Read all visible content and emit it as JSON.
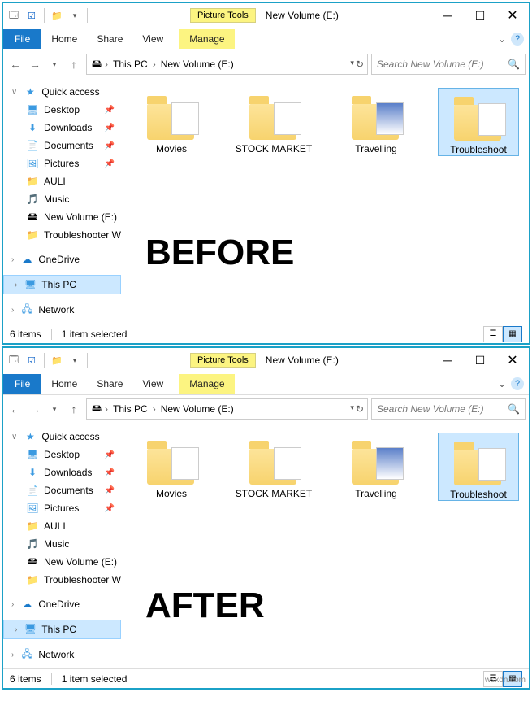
{
  "watermark": "wsxdn.com",
  "windows": [
    {
      "overlay": "BEFORE",
      "title": "New Volume (E:)",
      "contextTab": "Picture Tools",
      "ribbon": {
        "file": "File",
        "tabs": [
          "Home",
          "Share",
          "View"
        ],
        "manage": "Manage"
      },
      "breadcrumb": [
        "This PC",
        "New Volume (E:)"
      ],
      "searchPlaceholder": "Search New Volume (E:)",
      "nav": {
        "quickAccess": "Quick access",
        "items": [
          "Desktop",
          "Downloads",
          "Documents",
          "Pictures",
          "AULI",
          "Music",
          "New Volume (E:)",
          "Troubleshooter W"
        ],
        "oneDrive": "OneDrive",
        "thisPC": "This PC",
        "network": "Network"
      },
      "folders": [
        "Movies",
        "STOCK MARKET",
        "Travelling",
        "Troubleshoot"
      ],
      "selectedIndex": 3,
      "status": {
        "items": "6 items",
        "selected": "1 item selected"
      }
    },
    {
      "overlay": "AFTER",
      "title": "New Volume (E:)",
      "contextTab": "Picture Tools",
      "ribbon": {
        "file": "File",
        "tabs": [
          "Home",
          "Share",
          "View"
        ],
        "manage": "Manage"
      },
      "breadcrumb": [
        "This PC",
        "New Volume (E:)"
      ],
      "searchPlaceholder": "Search New Volume (E:)",
      "nav": {
        "quickAccess": "Quick access",
        "items": [
          "Desktop",
          "Downloads",
          "Documents",
          "Pictures",
          "AULI",
          "Music",
          "New Volume (E:)",
          "Troubleshooter W"
        ],
        "oneDrive": "OneDrive",
        "thisPC": "This PC",
        "network": "Network"
      },
      "folders": [
        "Movies",
        "STOCK MARKET",
        "Travelling",
        "Troubleshoot"
      ],
      "selectedIndex": 3,
      "status": {
        "items": "6 items",
        "selected": "1 item selected"
      }
    }
  ]
}
